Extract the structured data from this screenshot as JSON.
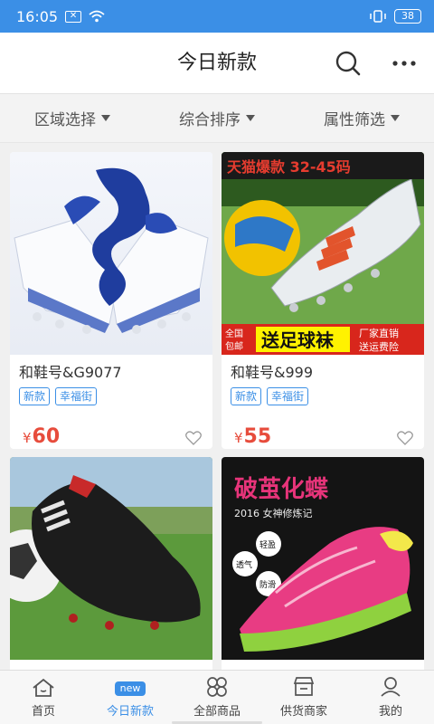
{
  "status_bar": {
    "time": "16:05",
    "battery": "38"
  },
  "header": {
    "title": "今日新款"
  },
  "filters": [
    {
      "label": "区域选择"
    },
    {
      "label": "综合排序"
    },
    {
      "label": "属性筛选"
    }
  ],
  "products": [
    {
      "name": "和鞋号&G9077",
      "tags": [
        "新款",
        "幸福街"
      ],
      "currency": "¥",
      "price": "60"
    },
    {
      "name": "和鞋号&999",
      "tags": [
        "新款",
        "幸福街"
      ],
      "currency": "¥",
      "price": "55"
    },
    {
      "name": "",
      "tags": [],
      "currency": "",
      "price": ""
    },
    {
      "name": "",
      "tags": [],
      "currency": "",
      "price": ""
    }
  ],
  "product2_image_text": {
    "banner_top": "天猫爆款 32-45码",
    "banner_left_line1": "全国",
    "banner_left_line2": "包邮",
    "banner_center": "送足球袜",
    "banner_right_line1": "厂家直销",
    "banner_right_line2": "送运费险"
  },
  "product4_image_text": {
    "headline": "破茧化蝶",
    "subline": "2016 女神修炼记",
    "badge1": "轻盈",
    "badge2": "透气",
    "badge3": "防滑"
  },
  "bottom_nav": [
    {
      "label": "首页",
      "icon": "home-icon"
    },
    {
      "label": "今日新款",
      "icon": "new-icon",
      "badge": "new",
      "active": true
    },
    {
      "label": "全部商品",
      "icon": "grid-icon"
    },
    {
      "label": "供货商家",
      "icon": "store-icon"
    },
    {
      "label": "我的",
      "icon": "user-icon"
    }
  ],
  "colors": {
    "accent": "#3b8fe6",
    "price": "#e74c3c",
    "status_bar": "#3b8fe6"
  }
}
